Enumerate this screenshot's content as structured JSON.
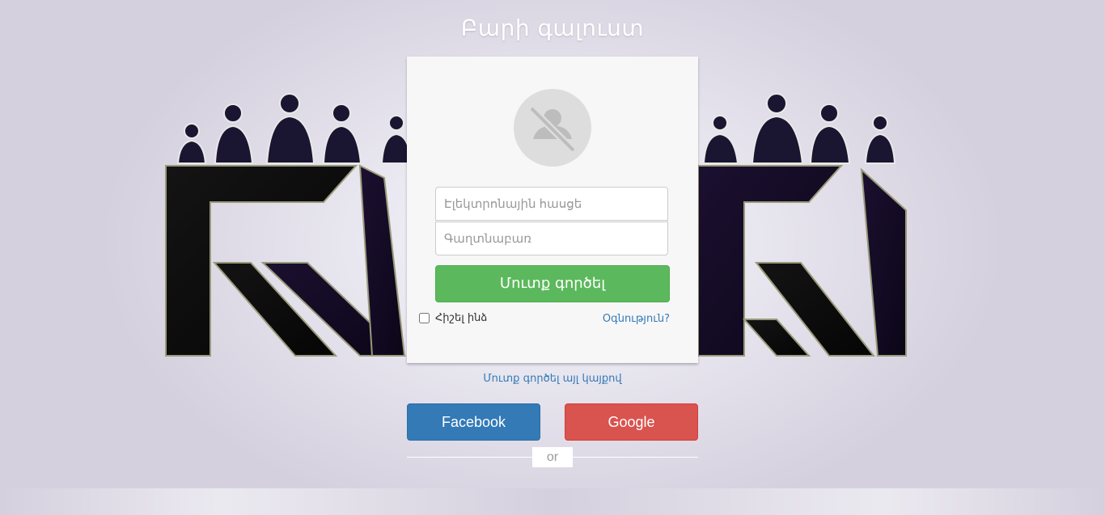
{
  "header": {
    "title": "Բարի գալուստ"
  },
  "login_form": {
    "email_placeholder": "Էլեկտրոնային հասցե",
    "password_placeholder": "Գաղտնաբառ",
    "submit_label": "Մուտք գործել",
    "remember_label": "Հիշել ինձ",
    "remember_checked": false,
    "help_label": "Օգնություն?"
  },
  "alt_login": {
    "label": "Մուտք գործել այլ կայքով"
  },
  "social": {
    "facebook_label": "Facebook",
    "google_label": "Google",
    "or_label": "or"
  },
  "colors": {
    "submit": "#5cb85c",
    "facebook": "#337ab7",
    "google": "#d9534f",
    "link": "#337ab7",
    "background": "#d6d2e0"
  },
  "icons": {
    "avatar": "no-user-icon"
  }
}
